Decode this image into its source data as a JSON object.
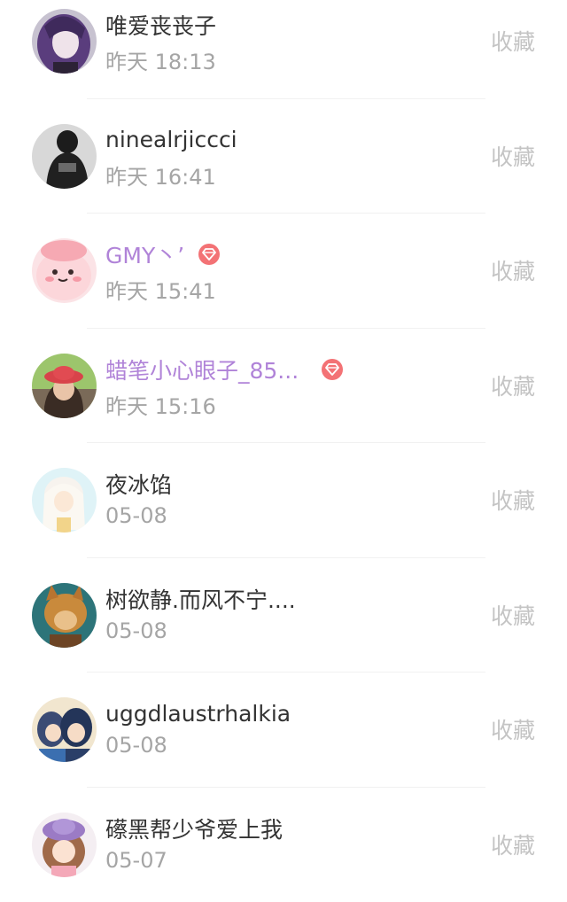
{
  "fav_label": "收藏",
  "items": [
    {
      "name": "唯爱丧丧子",
      "time": "昨天 18:13",
      "vip": false,
      "avatar": "avatar-purple-hair"
    },
    {
      "name": "ninealrjiccci",
      "time": "昨天 16:41",
      "vip": false,
      "avatar": "avatar-dark-hoodie"
    },
    {
      "name": "GMY丶’",
      "time": "昨天 15:41",
      "vip": true,
      "avatar": "avatar-pink-cartoon"
    },
    {
      "name": "蜡笔小心眼子_85...",
      "time": "昨天 15:16",
      "vip": true,
      "avatar": "avatar-red-hat-girl"
    },
    {
      "name": "夜冰馅",
      "time": "05-08",
      "vip": false,
      "avatar": "avatar-white-anime"
    },
    {
      "name": "树欲静.而风不宁....",
      "time": "05-08",
      "vip": false,
      "avatar": "avatar-cat-teal"
    },
    {
      "name": "uggdlaustrhalkia",
      "time": "05-08",
      "vip": false,
      "avatar": "avatar-couple-blue"
    },
    {
      "name": "礤黑帮少爷爱上我",
      "time": "05-07",
      "vip": false,
      "avatar": "avatar-purple-hat-girl"
    }
  ],
  "colors": {
    "vip_name": "#b083d8",
    "vip_badge": "#f37275",
    "name": "#333333",
    "time": "#a5a5a5",
    "fav": "#c4c4c4"
  }
}
